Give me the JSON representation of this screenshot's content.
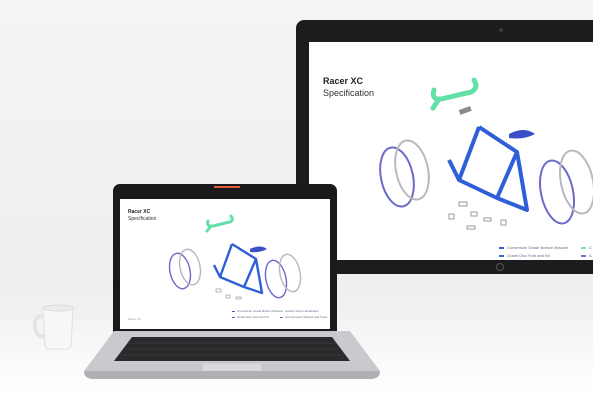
{
  "monitor": {
    "title": "Racer XC",
    "subtitle": "Specification",
    "legend": [
      {
        "label": "Conversion Grade Bottom Bracket",
        "color": "#3a5bd9"
      },
      {
        "label": "Grade Disc Fork and Kit",
        "color": "#2f6fd6"
      },
      {
        "label": "C",
        "color": "#8fd9b0"
      },
      {
        "label": "A",
        "color": "#7b6fd0"
      }
    ]
  },
  "laptop": {
    "title": "Racer XC",
    "subtitle": "Specification",
    "legend": [
      {
        "label": "Conversion Grade Bottom Bracket",
        "color": "#3a5bd9"
      },
      {
        "label": "Grade Disc Fork and Kit",
        "color": "#2f6fd6"
      },
      {
        "label": "Carbon Fibre Handlebars",
        "color": "#8fd9b0"
      },
      {
        "label": "Aerodynamic Wheels and Tyres",
        "color": "#7b6fd0"
      }
    ],
    "footer": "Racer XC"
  },
  "colors": {
    "frame": "#2f5fd8",
    "handlebar": "#63e0a8",
    "saddle": "#3b4fc6",
    "wheel_blue": "#6a6ac8",
    "wheel_grey": "#b8b8c0",
    "accent": "#e25a3a"
  }
}
